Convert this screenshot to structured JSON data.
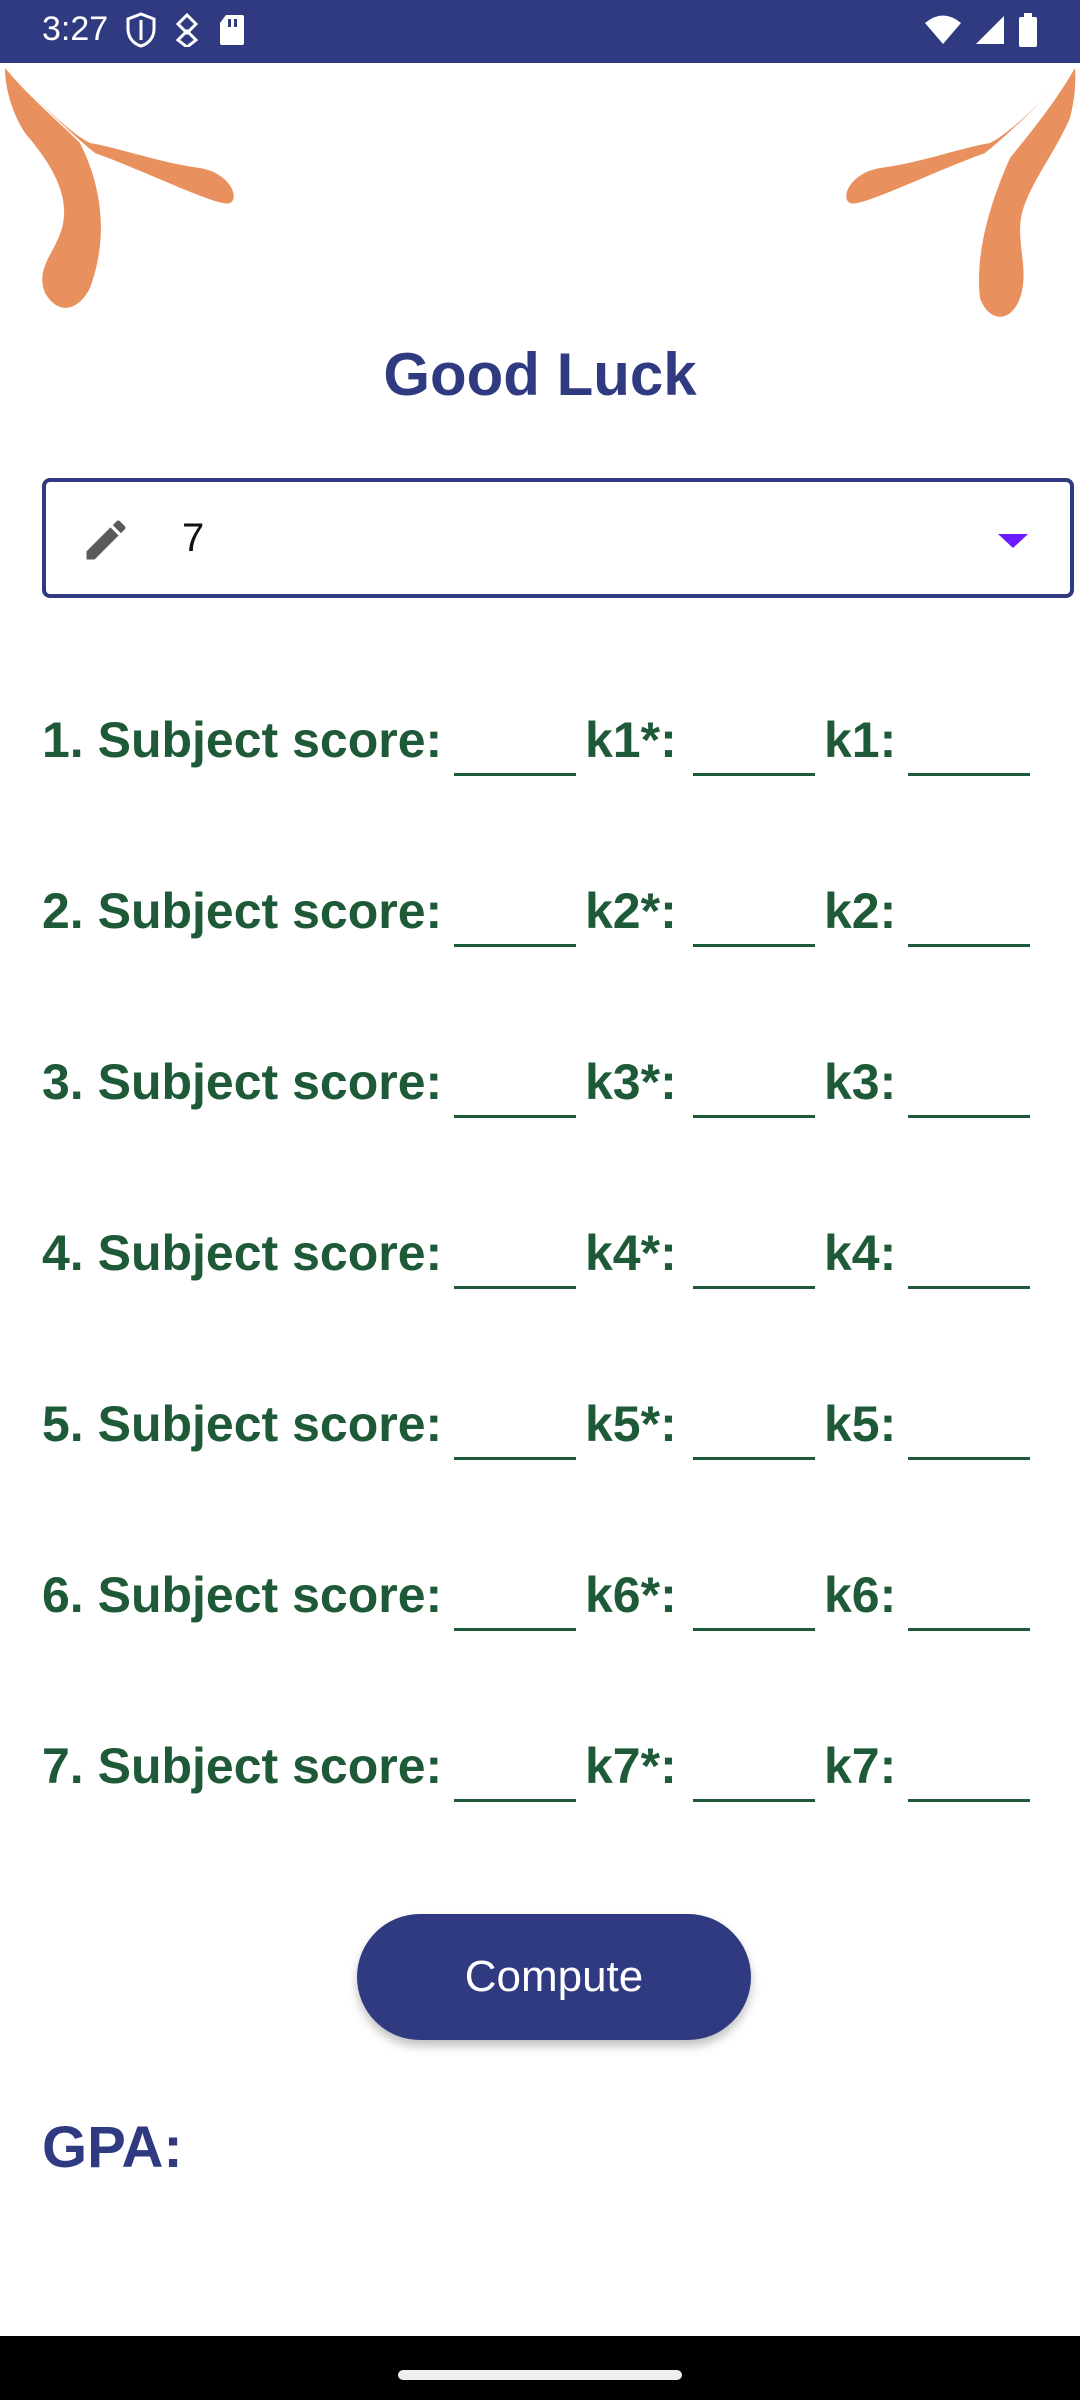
{
  "status": {
    "time": "3:27"
  },
  "app": {
    "title": "Good Luck"
  },
  "dropdown": {
    "value": "7"
  },
  "rows": [
    {
      "score_label": "1. Subject score:",
      "kstar_label": "k1*:",
      "k_label": "k1:"
    },
    {
      "score_label": "2. Subject score:",
      "kstar_label": "k2*:",
      "k_label": "k2:"
    },
    {
      "score_label": "3. Subject score:",
      "kstar_label": "k3*:",
      "k_label": "k3:"
    },
    {
      "score_label": "4. Subject score:",
      "kstar_label": "k4*:",
      "k_label": "k4:"
    },
    {
      "score_label": "5. Subject score:",
      "kstar_label": "k5*:",
      "k_label": "k5:"
    },
    {
      "score_label": "6. Subject score:",
      "kstar_label": "k6*:",
      "k_label": "k6:"
    },
    {
      "score_label": "7. Subject score:",
      "kstar_label": "k7*:",
      "k_label": "k7:"
    }
  ],
  "actions": {
    "compute_label": "Compute"
  },
  "result": {
    "gpa_label": "GPA:"
  },
  "colors": {
    "primary": "#2f3a80",
    "label_green": "#1e5a37",
    "decoration_orange": "#e8915f",
    "dropdown_arrow": "#6a1bff"
  },
  "icons": {
    "status_left": [
      "shield-icon",
      "data-saver-icon",
      "sd-card-icon"
    ],
    "status_right": [
      "wifi-icon",
      "cellular-signal-icon",
      "battery-icon"
    ],
    "dropdown_left": "pencil-icon",
    "dropdown_right": "chevron-down-icon"
  }
}
